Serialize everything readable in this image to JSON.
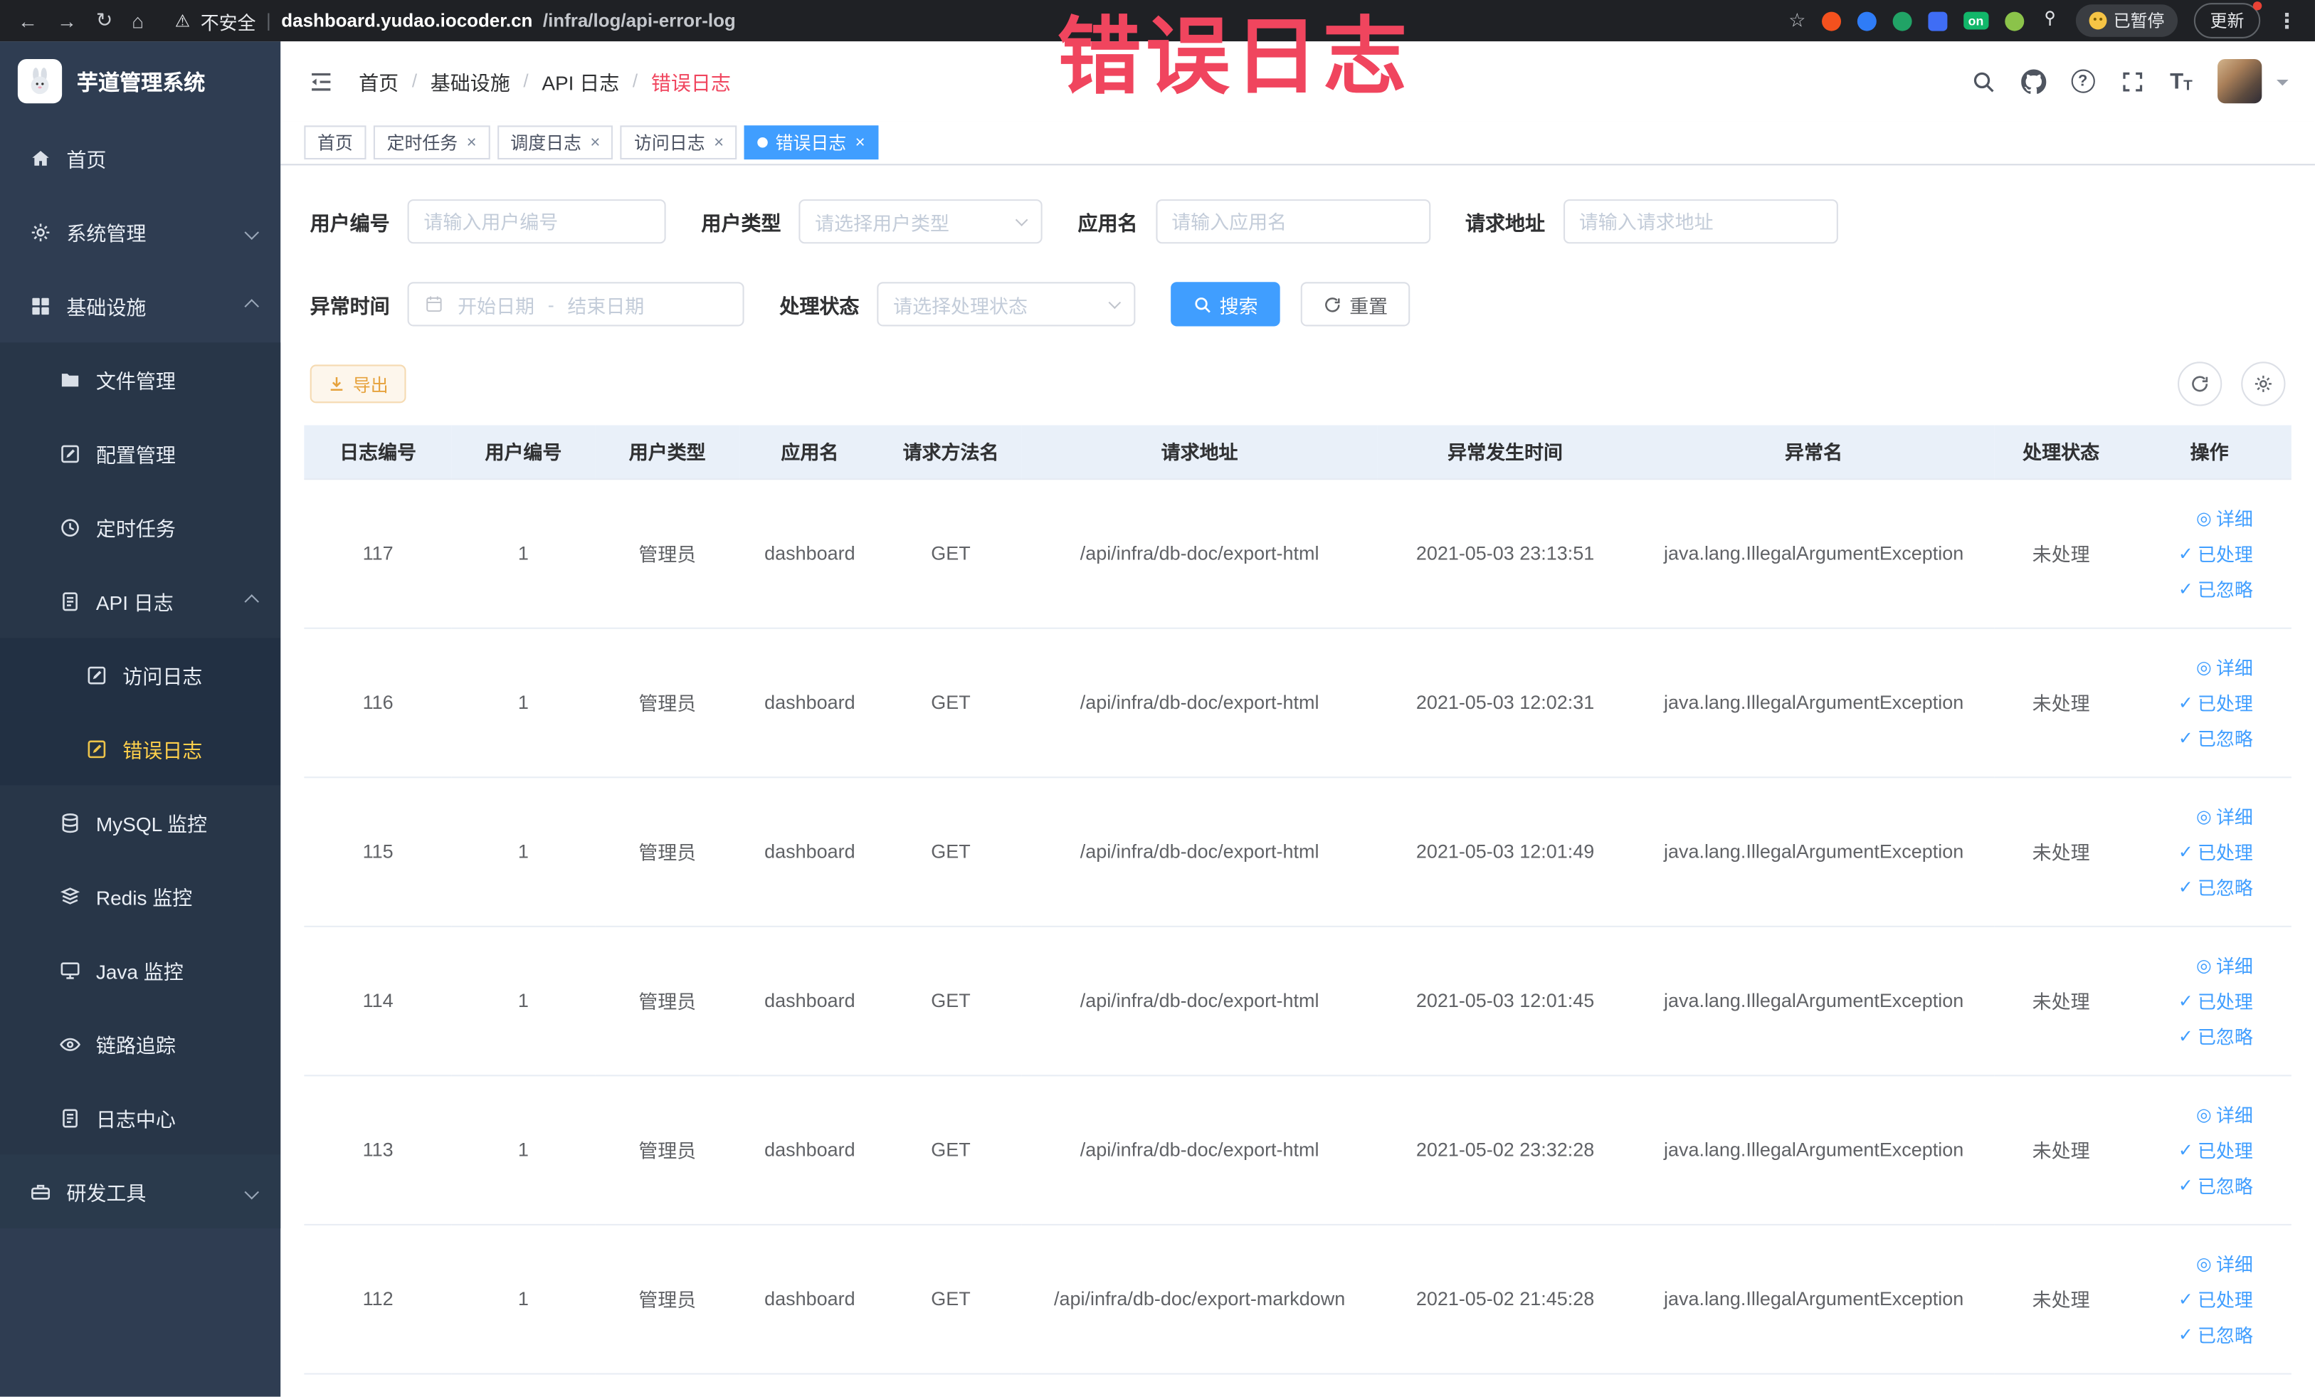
{
  "colors": {
    "primary": "#409eff",
    "sidebar_active": "#ffd04b",
    "warning": "#e6a23c",
    "annotation": "#f0455e",
    "tab_active_bg": "#409eff"
  },
  "annotation": {
    "text": "错误日志"
  },
  "browser": {
    "security_label": "不安全",
    "url_domain": "dashboard.yudao.iocoder.cn",
    "url_path": "/infra/log/api-error-log",
    "paused_badge": "已暂停",
    "update_button": "更新",
    "extension_on_badge": "on"
  },
  "sidebar": {
    "title": "芋道管理系统",
    "items": [
      {
        "label": "首页"
      },
      {
        "label": "系统管理"
      },
      {
        "label": "基础设施"
      },
      {
        "label": "文件管理"
      },
      {
        "label": "配置管理"
      },
      {
        "label": "定时任务"
      },
      {
        "label": "API 日志"
      },
      {
        "label": "访问日志"
      },
      {
        "label": "错误日志",
        "active": true
      },
      {
        "label": "MySQL 监控"
      },
      {
        "label": "Redis 监控"
      },
      {
        "label": "Java 监控"
      },
      {
        "label": "链路追踪"
      },
      {
        "label": "日志中心"
      },
      {
        "label": "研发工具"
      }
    ]
  },
  "breadcrumb": {
    "items": [
      "首页",
      "基础设施",
      "API 日志",
      "错误日志"
    ],
    "separator": "/"
  },
  "tabs": [
    {
      "label": "首页",
      "closable": false,
      "active": false
    },
    {
      "label": "定时任务",
      "closable": true,
      "active": false
    },
    {
      "label": "调度日志",
      "closable": true,
      "active": false
    },
    {
      "label": "访问日志",
      "closable": true,
      "active": false
    },
    {
      "label": "错误日志",
      "closable": true,
      "active": true
    }
  ],
  "filters": {
    "user_id": {
      "label": "用户编号",
      "placeholder": "请输入用户编号"
    },
    "user_type": {
      "label": "用户类型",
      "placeholder": "请选择用户类型"
    },
    "app_name": {
      "label": "应用名",
      "placeholder": "请输入应用名"
    },
    "request_url": {
      "label": "请求地址",
      "placeholder": "请输入请求地址"
    },
    "exception_time": {
      "label": "异常时间",
      "start": "开始日期",
      "separator": "-",
      "end": "结束日期"
    },
    "process_status": {
      "label": "处理状态",
      "placeholder": "请选择处理状态"
    },
    "search_button": "搜索",
    "reset_button": "重置"
  },
  "toolbar": {
    "export_button": "导出"
  },
  "table": {
    "columns": [
      "日志编号",
      "用户编号",
      "用户类型",
      "应用名",
      "请求方法名",
      "请求地址",
      "异常发生时间",
      "异常名",
      "处理状态",
      "操作"
    ],
    "actions": [
      "详细",
      "已处理",
      "已忽略"
    ],
    "rows": [
      {
        "id": "117",
        "user_id": "1",
        "user_type": "管理员",
        "app": "dashboard",
        "method": "GET",
        "url": "/api/infra/db-doc/export-html",
        "time": "2021-05-03 23:13:51",
        "exception": "java.lang.IllegalArgumentException",
        "status": "未处理"
      },
      {
        "id": "116",
        "user_id": "1",
        "user_type": "管理员",
        "app": "dashboard",
        "method": "GET",
        "url": "/api/infra/db-doc/export-html",
        "time": "2021-05-03 12:02:31",
        "exception": "java.lang.IllegalArgumentException",
        "status": "未处理"
      },
      {
        "id": "115",
        "user_id": "1",
        "user_type": "管理员",
        "app": "dashboard",
        "method": "GET",
        "url": "/api/infra/db-doc/export-html",
        "time": "2021-05-03 12:01:49",
        "exception": "java.lang.IllegalArgumentException",
        "status": "未处理"
      },
      {
        "id": "114",
        "user_id": "1",
        "user_type": "管理员",
        "app": "dashboard",
        "method": "GET",
        "url": "/api/infra/db-doc/export-html",
        "time": "2021-05-03 12:01:45",
        "exception": "java.lang.IllegalArgumentException",
        "status": "未处理"
      },
      {
        "id": "113",
        "user_id": "1",
        "user_type": "管理员",
        "app": "dashboard",
        "method": "GET",
        "url": "/api/infra/db-doc/export-html",
        "time": "2021-05-02 23:32:28",
        "exception": "java.lang.IllegalArgumentException",
        "status": "未处理"
      },
      {
        "id": "112",
        "user_id": "1",
        "user_type": "管理员",
        "app": "dashboard",
        "method": "GET",
        "url": "/api/infra/db-doc/export-markdown",
        "time": "2021-05-02 21:45:28",
        "exception": "java.lang.IllegalArgumentException",
        "status": "未处理"
      }
    ]
  }
}
